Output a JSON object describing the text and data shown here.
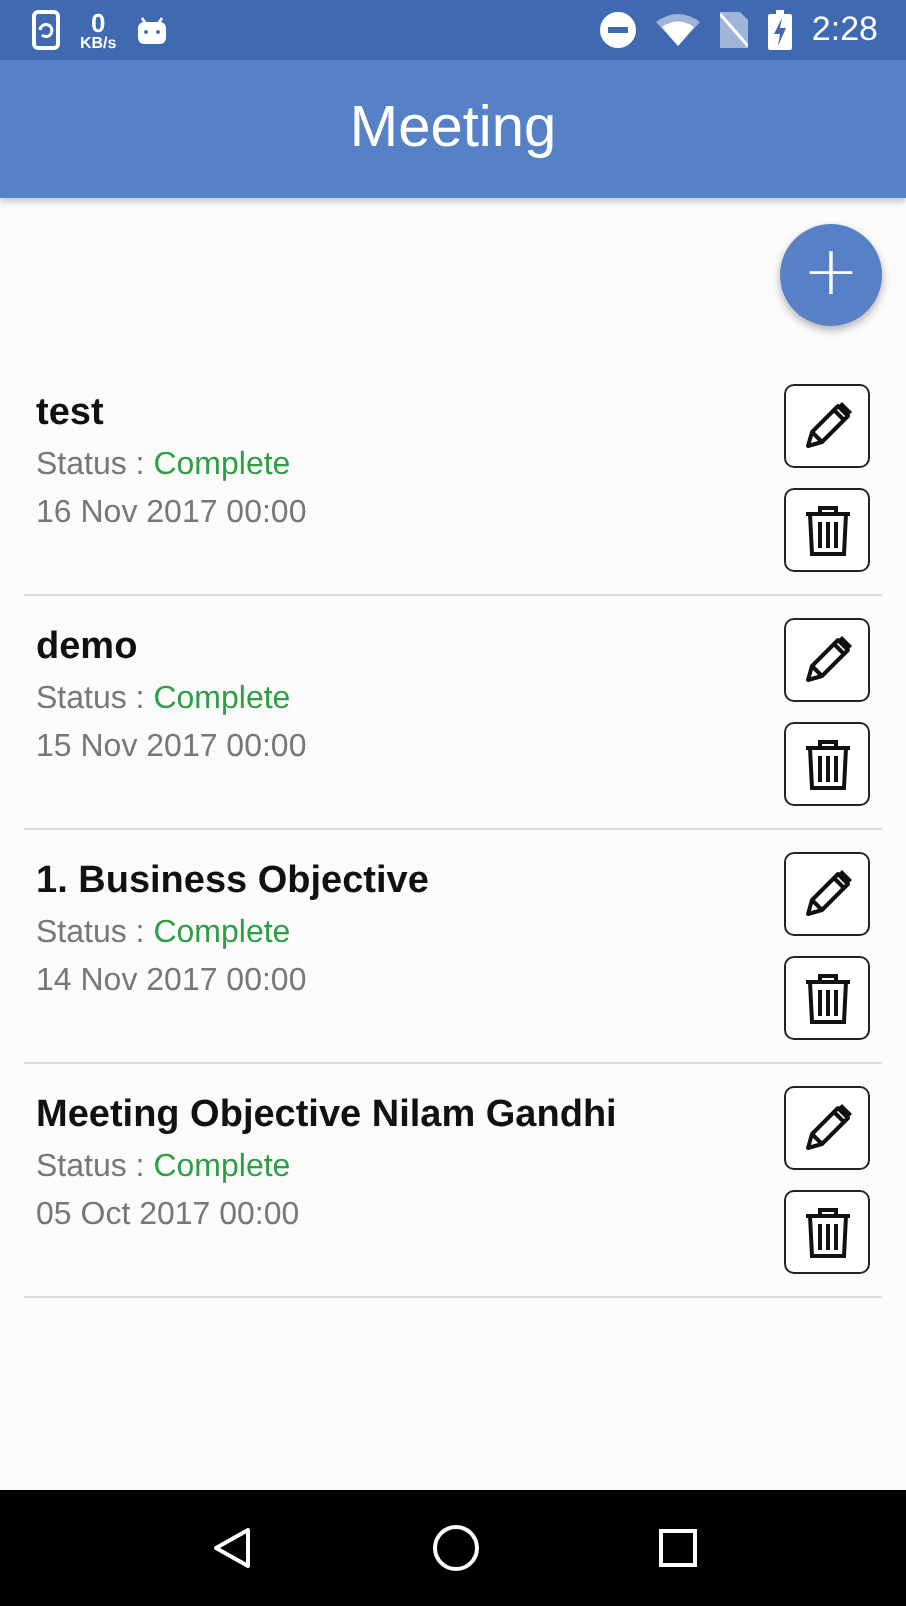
{
  "status_bar": {
    "speed_value": "0",
    "speed_unit": "KB/s",
    "time": "2:28"
  },
  "app_bar": {
    "title": "Meeting"
  },
  "add_button": {
    "label": "+"
  },
  "meetings": [
    {
      "title": "test",
      "status_label": "Status :",
      "status": "Complete",
      "date": "16 Nov 2017 00:00"
    },
    {
      "title": "demo",
      "status_label": "Status :",
      "status": "Complete",
      "date": "15 Nov 2017 00:00"
    },
    {
      "title": "1. Business Objective",
      "status_label": "Status :",
      "status": "Complete",
      "date": "14 Nov 2017 00:00"
    },
    {
      "title": "Meeting Objective Nilam Gandhi",
      "status_label": "Status :",
      "status": "Complete",
      "date": "05 Oct 2017 00:00"
    }
  ]
}
